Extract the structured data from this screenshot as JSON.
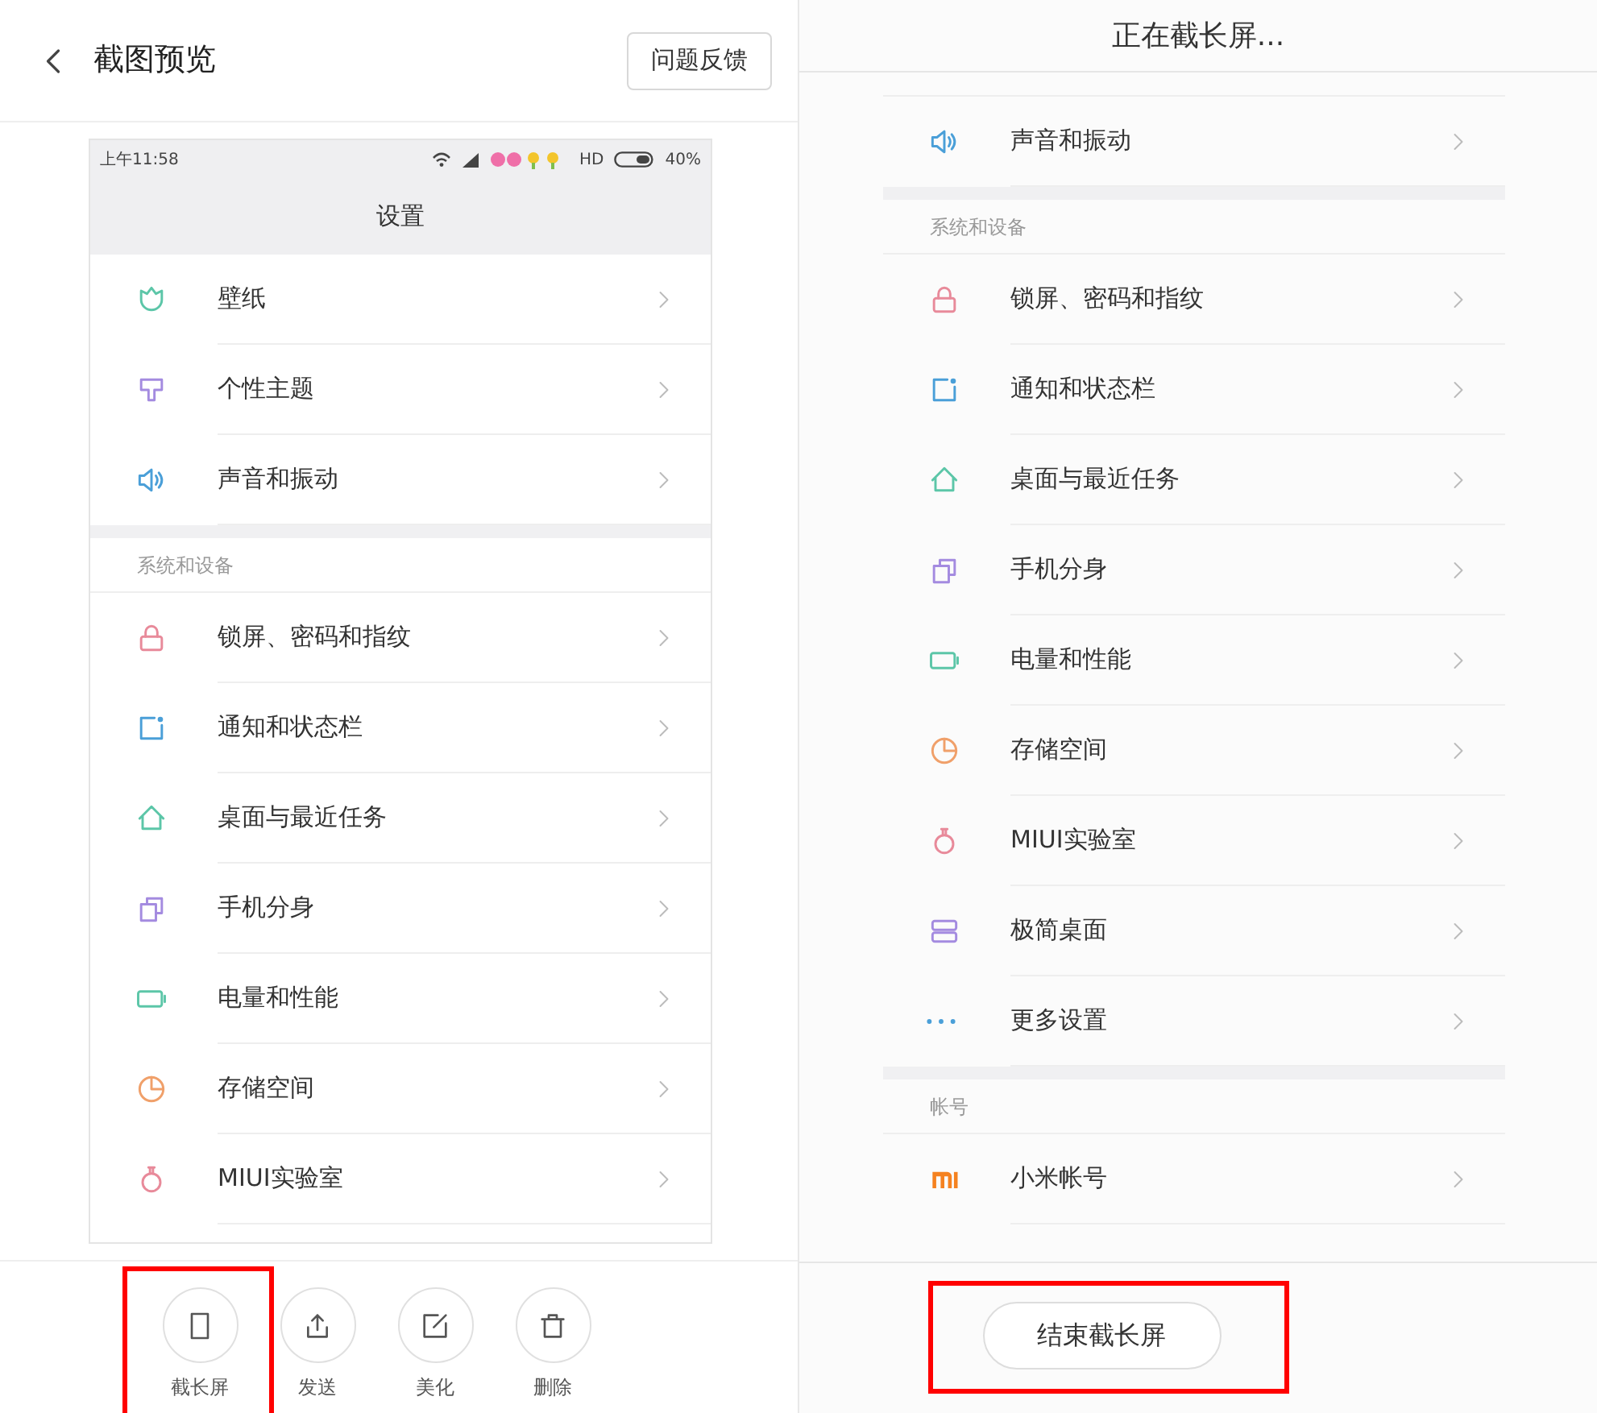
{
  "left": {
    "header": {
      "title": "截图预览",
      "button": "问题反馈"
    },
    "phone": {
      "status": {
        "time": "上午11:58",
        "network": "HD",
        "battery": "40%"
      },
      "title": "设置",
      "groups": [
        {
          "items": [
            {
              "label": "壁纸",
              "kind": "wallpaper"
            },
            {
              "label": "个性主题",
              "kind": "theme"
            },
            {
              "label": "声音和振动",
              "kind": "sound"
            }
          ]
        },
        {
          "header": "系统和设备",
          "items": [
            {
              "label": "锁屏、密码和指纹",
              "kind": "lock"
            },
            {
              "label": "通知和状态栏",
              "kind": "notification"
            },
            {
              "label": "桌面与最近任务",
              "kind": "home"
            },
            {
              "label": "手机分身",
              "kind": "clone"
            },
            {
              "label": "电量和性能",
              "kind": "battery"
            },
            {
              "label": "存储空间",
              "kind": "storage"
            },
            {
              "label": "MIUI实验室",
              "kind": "lab"
            }
          ]
        }
      ]
    },
    "actions": [
      {
        "label": "截长屏",
        "kind": "long",
        "highlighted": true
      },
      {
        "label": "发送",
        "kind": "share",
        "highlighted": false
      },
      {
        "label": "美化",
        "kind": "edit",
        "highlighted": false
      },
      {
        "label": "删除",
        "kind": "delete",
        "highlighted": false
      }
    ]
  },
  "right": {
    "title": "正在截长屏...",
    "groups": [
      {
        "items": [
          {
            "label": "声音和振动",
            "kind": "sound"
          }
        ]
      },
      {
        "header": "系统和设备",
        "items": [
          {
            "label": "锁屏、密码和指纹",
            "kind": "lock"
          },
          {
            "label": "通知和状态栏",
            "kind": "notification"
          },
          {
            "label": "桌面与最近任务",
            "kind": "home"
          },
          {
            "label": "手机分身",
            "kind": "clone"
          },
          {
            "label": "电量和性能",
            "kind": "battery"
          },
          {
            "label": "存储空间",
            "kind": "storage"
          },
          {
            "label": "MIUI实验室",
            "kind": "lab"
          },
          {
            "label": "极简桌面",
            "kind": "simple"
          },
          {
            "label": "更多设置",
            "kind": "more"
          }
        ]
      },
      {
        "header": "帐号",
        "items": [
          {
            "label": "小米帐号",
            "kind": "mi"
          }
        ]
      }
    ],
    "button": {
      "label": "结束截长屏",
      "highlighted": true
    }
  }
}
